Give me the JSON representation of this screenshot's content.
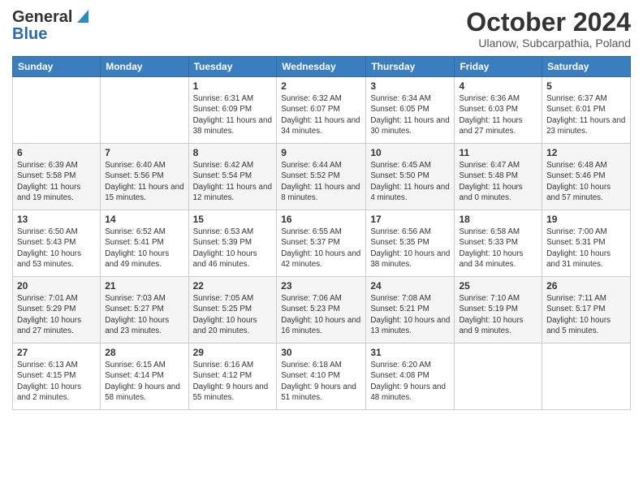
{
  "header": {
    "logo_general": "General",
    "logo_blue": "Blue",
    "month_title": "October 2024",
    "subtitle": "Ulanow, Subcarpathia, Poland"
  },
  "weekdays": [
    "Sunday",
    "Monday",
    "Tuesday",
    "Wednesday",
    "Thursday",
    "Friday",
    "Saturday"
  ],
  "weeks": [
    [
      {
        "day": "",
        "info": ""
      },
      {
        "day": "",
        "info": ""
      },
      {
        "day": "1",
        "info": "Sunrise: 6:31 AM\nSunset: 6:09 PM\nDaylight: 11 hours and 38 minutes."
      },
      {
        "day": "2",
        "info": "Sunrise: 6:32 AM\nSunset: 6:07 PM\nDaylight: 11 hours and 34 minutes."
      },
      {
        "day": "3",
        "info": "Sunrise: 6:34 AM\nSunset: 6:05 PM\nDaylight: 11 hours and 30 minutes."
      },
      {
        "day": "4",
        "info": "Sunrise: 6:36 AM\nSunset: 6:03 PM\nDaylight: 11 hours and 27 minutes."
      },
      {
        "day": "5",
        "info": "Sunrise: 6:37 AM\nSunset: 6:01 PM\nDaylight: 11 hours and 23 minutes."
      }
    ],
    [
      {
        "day": "6",
        "info": "Sunrise: 6:39 AM\nSunset: 5:58 PM\nDaylight: 11 hours and 19 minutes."
      },
      {
        "day": "7",
        "info": "Sunrise: 6:40 AM\nSunset: 5:56 PM\nDaylight: 11 hours and 15 minutes."
      },
      {
        "day": "8",
        "info": "Sunrise: 6:42 AM\nSunset: 5:54 PM\nDaylight: 11 hours and 12 minutes."
      },
      {
        "day": "9",
        "info": "Sunrise: 6:44 AM\nSunset: 5:52 PM\nDaylight: 11 hours and 8 minutes."
      },
      {
        "day": "10",
        "info": "Sunrise: 6:45 AM\nSunset: 5:50 PM\nDaylight: 11 hours and 4 minutes."
      },
      {
        "day": "11",
        "info": "Sunrise: 6:47 AM\nSunset: 5:48 PM\nDaylight: 11 hours and 0 minutes."
      },
      {
        "day": "12",
        "info": "Sunrise: 6:48 AM\nSunset: 5:46 PM\nDaylight: 10 hours and 57 minutes."
      }
    ],
    [
      {
        "day": "13",
        "info": "Sunrise: 6:50 AM\nSunset: 5:43 PM\nDaylight: 10 hours and 53 minutes."
      },
      {
        "day": "14",
        "info": "Sunrise: 6:52 AM\nSunset: 5:41 PM\nDaylight: 10 hours and 49 minutes."
      },
      {
        "day": "15",
        "info": "Sunrise: 6:53 AM\nSunset: 5:39 PM\nDaylight: 10 hours and 46 minutes."
      },
      {
        "day": "16",
        "info": "Sunrise: 6:55 AM\nSunset: 5:37 PM\nDaylight: 10 hours and 42 minutes."
      },
      {
        "day": "17",
        "info": "Sunrise: 6:56 AM\nSunset: 5:35 PM\nDaylight: 10 hours and 38 minutes."
      },
      {
        "day": "18",
        "info": "Sunrise: 6:58 AM\nSunset: 5:33 PM\nDaylight: 10 hours and 34 minutes."
      },
      {
        "day": "19",
        "info": "Sunrise: 7:00 AM\nSunset: 5:31 PM\nDaylight: 10 hours and 31 minutes."
      }
    ],
    [
      {
        "day": "20",
        "info": "Sunrise: 7:01 AM\nSunset: 5:29 PM\nDaylight: 10 hours and 27 minutes."
      },
      {
        "day": "21",
        "info": "Sunrise: 7:03 AM\nSunset: 5:27 PM\nDaylight: 10 hours and 23 minutes."
      },
      {
        "day": "22",
        "info": "Sunrise: 7:05 AM\nSunset: 5:25 PM\nDaylight: 10 hours and 20 minutes."
      },
      {
        "day": "23",
        "info": "Sunrise: 7:06 AM\nSunset: 5:23 PM\nDaylight: 10 hours and 16 minutes."
      },
      {
        "day": "24",
        "info": "Sunrise: 7:08 AM\nSunset: 5:21 PM\nDaylight: 10 hours and 13 minutes."
      },
      {
        "day": "25",
        "info": "Sunrise: 7:10 AM\nSunset: 5:19 PM\nDaylight: 10 hours and 9 minutes."
      },
      {
        "day": "26",
        "info": "Sunrise: 7:11 AM\nSunset: 5:17 PM\nDaylight: 10 hours and 5 minutes."
      }
    ],
    [
      {
        "day": "27",
        "info": "Sunrise: 6:13 AM\nSunset: 4:15 PM\nDaylight: 10 hours and 2 minutes."
      },
      {
        "day": "28",
        "info": "Sunrise: 6:15 AM\nSunset: 4:14 PM\nDaylight: 9 hours and 58 minutes."
      },
      {
        "day": "29",
        "info": "Sunrise: 6:16 AM\nSunset: 4:12 PM\nDaylight: 9 hours and 55 minutes."
      },
      {
        "day": "30",
        "info": "Sunrise: 6:18 AM\nSunset: 4:10 PM\nDaylight: 9 hours and 51 minutes."
      },
      {
        "day": "31",
        "info": "Sunrise: 6:20 AM\nSunset: 4:08 PM\nDaylight: 9 hours and 48 minutes."
      },
      {
        "day": "",
        "info": ""
      },
      {
        "day": "",
        "info": ""
      }
    ]
  ]
}
